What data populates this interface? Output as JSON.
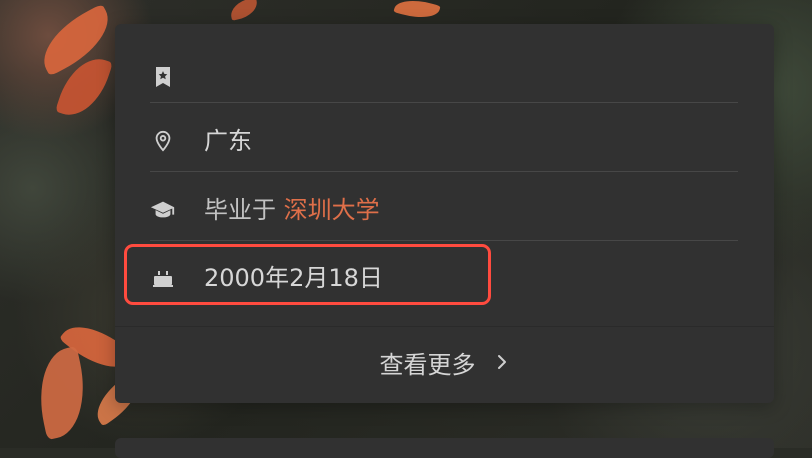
{
  "profile": {
    "location": "广东",
    "education_prefix": "毕业于",
    "education_school": "深圳大学",
    "birthday": "2000年2月18日",
    "more_label": "查看更多"
  },
  "icons": {
    "bookmark": "bookmark-icon",
    "location": "location-pin-icon",
    "education": "graduation-cap-icon",
    "birthday": "cake-icon",
    "chevron": "chevron-right-icon"
  },
  "colors": {
    "card_bg": "#313131",
    "text": "#d7d7d7",
    "link": "#df6f49",
    "highlight": "#ff4b3f"
  }
}
